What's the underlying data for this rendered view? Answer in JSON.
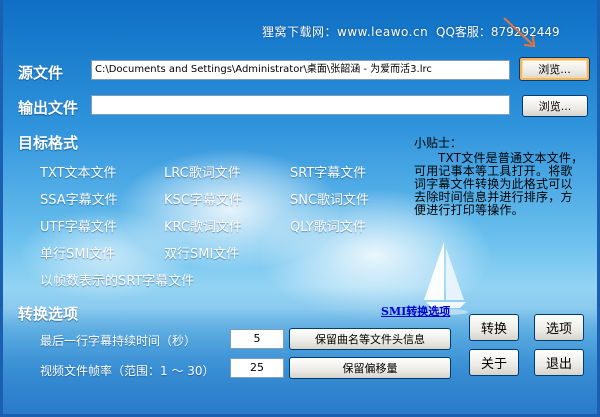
{
  "header": {
    "brand": "狸窝下载网：www.leawo.cn",
    "qq": "QQ客服：879292449"
  },
  "source": {
    "label": "源文件",
    "value": "C:\\Documents and Settings\\Administrator\\桌面\\张韶涵 - 为爱而活3.lrc",
    "browse_label": "浏览..."
  },
  "output": {
    "label": "输出文件",
    "value": "",
    "browse_label": "浏览..."
  },
  "formats": {
    "title": "目标格式",
    "items": [
      "TXT文本文件",
      "LRC歌词文件",
      "SRT字幕文件",
      "SSA字幕文件",
      "KSC字幕文件",
      "SNC歌词文件",
      "UTF字幕文件",
      "KRC歌词文件",
      "QLY歌词文件",
      "单行SMI文件",
      "双行SMI文件",
      "以帧数表示的SRT字幕文件"
    ]
  },
  "tips": {
    "title": "小贴士：",
    "body": "TXT文件是普通文本文件，可用记事本等工具打开。将歌词字幕文件转换为此格式可以去除时间信息并进行排序，方便进行打印等操作。"
  },
  "options": {
    "title": "转换选项",
    "smi_link": "SMI转换选项",
    "last_duration_label": "最后一行字幕持续时间（秒）",
    "last_duration_value": "5",
    "framerate_label": "视频文件帧率（范围：1 ～ 30）",
    "framerate_value": "25",
    "keep_header_label": "保留曲名等文件头信息",
    "keep_offset_label": "保留偏移量"
  },
  "actions": {
    "convert": "转换",
    "options": "选项",
    "about": "关于",
    "exit": "退出"
  },
  "colors": {
    "accent": "#1a6fc4",
    "link": "#0000cc"
  }
}
